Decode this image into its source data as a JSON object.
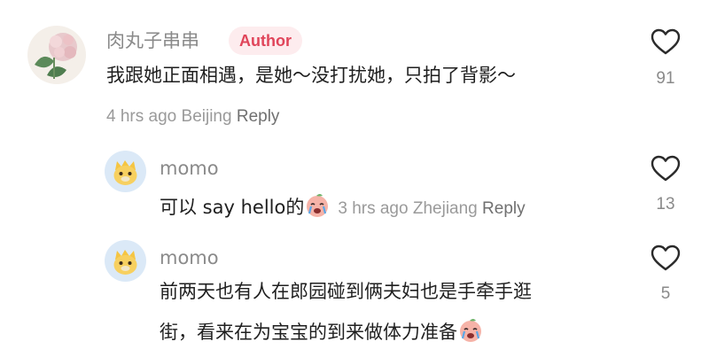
{
  "comments": [
    {
      "username": "肉丸子串串",
      "badge": "Author",
      "text": "我跟她正面相遇，是她～没打扰她，只拍了背影～",
      "time": "4 hrs ago",
      "location": "Beijing",
      "reply_label": "Reply",
      "likes": "91"
    },
    {
      "username": "momo",
      "text": "可以 say hello的",
      "emoji": "crying-face-emoji",
      "time": "3 hrs ago",
      "location": "Zhejiang",
      "reply_label": "Reply",
      "likes": "13"
    },
    {
      "username": "momo",
      "text_line1": "前两天也有人在郎园碰到俩夫妇也是手牵手逛",
      "text_line2": "街，看来在为宝宝的到来做体力准备",
      "emoji": "crying-face-emoji",
      "likes": "5"
    }
  ],
  "colors": {
    "badge_bg": "#fdecee",
    "badge_text": "#e0455a",
    "muted": "#9a9a9a"
  }
}
